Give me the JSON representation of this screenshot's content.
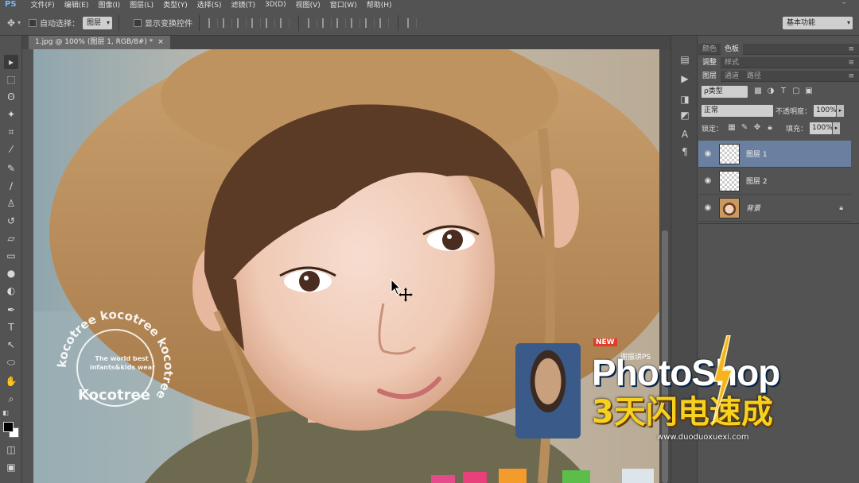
{
  "app": {
    "logo": "PS",
    "menu": [
      "文件(F)",
      "编辑(E)",
      "图像(I)",
      "图层(L)",
      "类型(Y)",
      "选择(S)",
      "滤镜(T)",
      "3D(D)",
      "视图(V)",
      "窗口(W)",
      "帮助(H)"
    ],
    "window_minimize": "–"
  },
  "options": {
    "auto_select_label": "自动选择：",
    "auto_select_value": "图层",
    "show_transform_label": "显示变换控件",
    "workspace": "基本功能"
  },
  "document": {
    "tab_title": "1.jpg @ 100% (图层 1, RGB/8#) *",
    "close": "×"
  },
  "panels": {
    "row1": [
      "颜色",
      "色板"
    ],
    "row2": [
      "调整",
      "样式"
    ],
    "row3": [
      "图层",
      "通道",
      "路径"
    ],
    "menu_glyph": "≡",
    "filter_kind": "ρ类型",
    "blend_mode": "正常",
    "opacity_label": "不透明度：",
    "opacity_value": "100%",
    "lock_label": "锁定：",
    "fill_label": "填充：",
    "fill_value": "100%",
    "layers": [
      {
        "name": "图层 1",
        "selected": true
      },
      {
        "name": "图层 2",
        "selected": false
      },
      {
        "name": "背景",
        "selected": false,
        "locked": true
      }
    ]
  },
  "watermark": {
    "ring_text": "kocotree kocotree kocotree",
    "line1": "The world best",
    "line2": "infants&kids wear",
    "brand": "Kocotree"
  },
  "promo": {
    "badge": "NEW",
    "subtitle": "谢振讲PS",
    "title": "PhotoShop",
    "chinese": "3天闪电速成",
    "url": "www.duoduoxuexi.com"
  }
}
